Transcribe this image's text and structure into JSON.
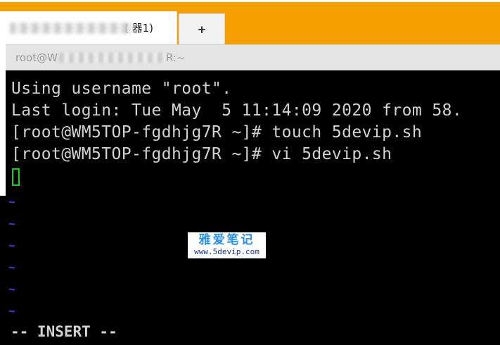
{
  "tabs": {
    "active_title": "(        器1)",
    "add_label": "+"
  },
  "window": {
    "title_prefix": "root@W",
    "title_suffix": "R:~"
  },
  "terminal": {
    "lines": [
      "Using username \"root\".",
      "Last login: Tue May  5 11:14:09 2020 from 58.",
      "[root@WM5TOP-fgdhjg7R ~]# touch 5devip.sh",
      "[root@WM5TOP-fgdhjg7R ~]# vi 5devip.sh"
    ],
    "tilde": "~",
    "status": "-- INSERT --"
  },
  "watermark": {
    "title": "雅爱笔记",
    "url": "www.5devip.com"
  },
  "colors": {
    "tabbar": "#f5a000",
    "terminal_bg": "#000000",
    "terminal_text": "#d2d2d2",
    "cursor": "#18d018",
    "tilde": "#3a46d8"
  }
}
